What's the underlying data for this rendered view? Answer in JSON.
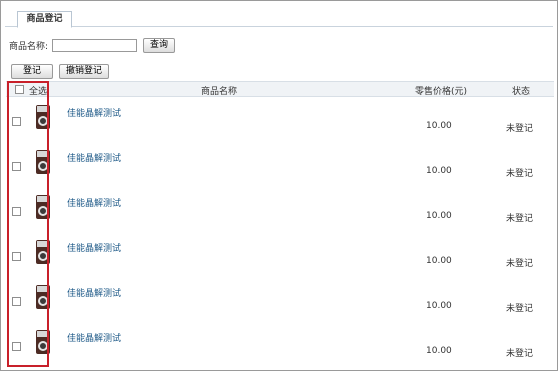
{
  "tab": {
    "label": "商品登记"
  },
  "search": {
    "label": "商品名称:",
    "value": "",
    "button": "查询"
  },
  "actions": {
    "register": "登记",
    "cancel": "撤销登记"
  },
  "table": {
    "headers": {
      "select_all": "全选",
      "name": "商品名称",
      "price": "零售价格(元)",
      "status": "状态"
    },
    "rows": [
      {
        "name": "佳能晶解测试",
        "price": "10.00",
        "status": "未登记"
      },
      {
        "name": "佳能晶解测试",
        "price": "10.00",
        "status": "未登记"
      },
      {
        "name": "佳能晶解测试",
        "price": "10.00",
        "status": "未登记"
      },
      {
        "name": "佳能晶解测试",
        "price": "10.00",
        "status": "未登记"
      },
      {
        "name": "佳能晶解测试",
        "price": "10.00",
        "status": "未登记"
      },
      {
        "name": "佳能晶解测试",
        "price": "10.00",
        "status": "未登记"
      }
    ]
  },
  "colors": {
    "link": "#1f5a88",
    "highlight": "#c8202a",
    "header_bg": "#f0f3f6"
  },
  "icons": {
    "product_thumb": "camera-icon"
  }
}
